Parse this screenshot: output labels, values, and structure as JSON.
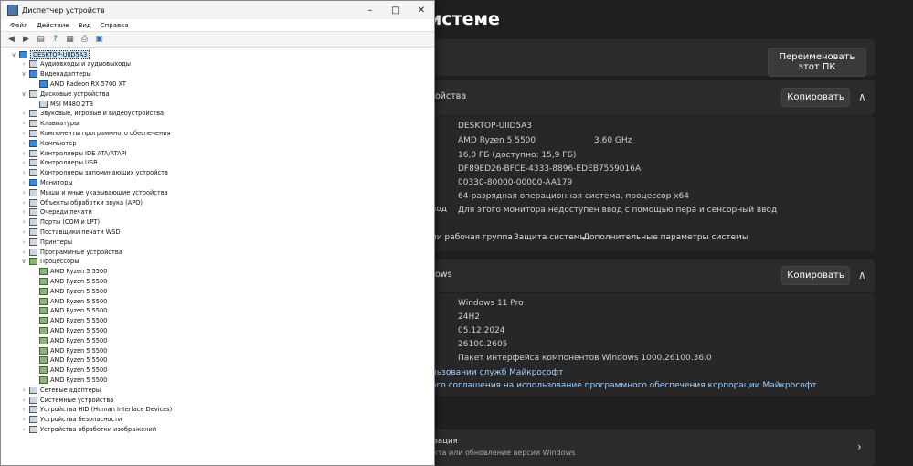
{
  "settings": {
    "title": "истеме",
    "rename_button": "Переименовать этот ПК",
    "device_spec_label": "ойства",
    "copy_button": "Копировать",
    "specs": [
      "DESKTOP-UIID5A3",
      "AMD Ryzen 5 5500",
      "16,0 ГБ (доступно: 15,9 ГБ)",
      "DF89ED26-BFCE-4333-8896-EDEB7559016A",
      "00330-80000-00000-AA179",
      "64-разрядная операционная система, процессор x64",
      "Для этого монитора недоступен ввод с помощью пера и сенсорный ввод"
    ],
    "cpu_freq": "3.60 GHz",
    "pen_label": "вод",
    "related_links": [
      "ли рабочая группа",
      "Защита системы",
      "Дополнительные параметры системы"
    ],
    "windows_spec_label": "ows",
    "windows_copy_button": "Копировать",
    "win_specs": [
      "Windows 11 Pro",
      "24H2",
      "05.12.2024",
      "26100.2605",
      "Пакет интерфейса компонентов Windows 1000.26100.36.0"
    ],
    "ms_links": [
      "льзовании служб Майкрософт",
      "ого соглашения на использование программного обеспечения корпорации Майкрософт"
    ],
    "activation_title": "вация",
    "activation_sub": "кта или обновление версии Windows"
  },
  "device_manager": {
    "title": "Диспетчер устройств",
    "menu": [
      "Файл",
      "Действие",
      "Вид",
      "Справка"
    ],
    "tree": [
      {
        "level": 0,
        "expander": "∨",
        "icon": "mon",
        "label": "DESKTOP-UIID5A3",
        "selected": true
      },
      {
        "level": 1,
        "expander": "›",
        "icon": "",
        "label": "Аудиовходы и аудиовыходы"
      },
      {
        "level": 1,
        "expander": "∨",
        "icon": "mon",
        "label": "Видеоадаптеры"
      },
      {
        "level": 2,
        "expander": "",
        "icon": "mon",
        "label": "AMD Radeon RX 5700 XT"
      },
      {
        "level": 1,
        "expander": "∨",
        "icon": "",
        "label": "Дисковые устройства"
      },
      {
        "level": 2,
        "expander": "",
        "icon": "",
        "label": "MSI M480 2TB"
      },
      {
        "level": 1,
        "expander": "›",
        "icon": "",
        "label": "Звуковые, игровые и видеоустройства"
      },
      {
        "level": 1,
        "expander": "›",
        "icon": "",
        "label": "Клавиатуры"
      },
      {
        "level": 1,
        "expander": "›",
        "icon": "",
        "label": "Компоненты программного обеспечения"
      },
      {
        "level": 1,
        "expander": "›",
        "icon": "mon",
        "label": "Компьютер"
      },
      {
        "level": 1,
        "expander": "›",
        "icon": "",
        "label": "Контроллеры IDE ATA/ATAPI"
      },
      {
        "level": 1,
        "expander": "›",
        "icon": "",
        "label": "Контроллеры USB"
      },
      {
        "level": 1,
        "expander": "›",
        "icon": "",
        "label": "Контроллеры запоминающих устройств"
      },
      {
        "level": 1,
        "expander": "›",
        "icon": "mon",
        "label": "Мониторы"
      },
      {
        "level": 1,
        "expander": "›",
        "icon": "",
        "label": "Мыши и иные указывающие устройства"
      },
      {
        "level": 1,
        "expander": "›",
        "icon": "",
        "label": "Объекты обработки звука (APO)"
      },
      {
        "level": 1,
        "expander": "›",
        "icon": "",
        "label": "Очереди печати"
      },
      {
        "level": 1,
        "expander": "›",
        "icon": "",
        "label": "Порты (COM и LPT)"
      },
      {
        "level": 1,
        "expander": "›",
        "icon": "",
        "label": "Поставщики печати WSD"
      },
      {
        "level": 1,
        "expander": "›",
        "icon": "",
        "label": "Принтеры"
      },
      {
        "level": 1,
        "expander": "›",
        "icon": "",
        "label": "Программные устройства"
      },
      {
        "level": 1,
        "expander": "∨",
        "icon": "cpu",
        "label": "Процессоры"
      },
      {
        "level": 2,
        "expander": "",
        "icon": "cpu",
        "label": "AMD Ryzen 5 5500"
      },
      {
        "level": 2,
        "expander": "",
        "icon": "cpu",
        "label": "AMD Ryzen 5 5500"
      },
      {
        "level": 2,
        "expander": "",
        "icon": "cpu",
        "label": "AMD Ryzen 5 5500"
      },
      {
        "level": 2,
        "expander": "",
        "icon": "cpu",
        "label": "AMD Ryzen 5 5500"
      },
      {
        "level": 2,
        "expander": "",
        "icon": "cpu",
        "label": "AMD Ryzen 5 5500"
      },
      {
        "level": 2,
        "expander": "",
        "icon": "cpu",
        "label": "AMD Ryzen 5 5500"
      },
      {
        "level": 2,
        "expander": "",
        "icon": "cpu",
        "label": "AMD Ryzen 5 5500"
      },
      {
        "level": 2,
        "expander": "",
        "icon": "cpu",
        "label": "AMD Ryzen 5 5500"
      },
      {
        "level": 2,
        "expander": "",
        "icon": "cpu",
        "label": "AMD Ryzen 5 5500"
      },
      {
        "level": 2,
        "expander": "",
        "icon": "cpu",
        "label": "AMD Ryzen 5 5500"
      },
      {
        "level": 2,
        "expander": "",
        "icon": "cpu",
        "label": "AMD Ryzen 5 5500"
      },
      {
        "level": 2,
        "expander": "",
        "icon": "cpu",
        "label": "AMD Ryzen 5 5500"
      },
      {
        "level": 1,
        "expander": "›",
        "icon": "",
        "label": "Сетевые адаптеры"
      },
      {
        "level": 1,
        "expander": "›",
        "icon": "",
        "label": "Системные устройства"
      },
      {
        "level": 1,
        "expander": "›",
        "icon": "",
        "label": "Устройства HID (Human Interface Devices)"
      },
      {
        "level": 1,
        "expander": "›",
        "icon": "",
        "label": "Устройства безопасности"
      },
      {
        "level": 1,
        "expander": "›",
        "icon": "",
        "label": "Устройства обработки изображений"
      }
    ]
  }
}
